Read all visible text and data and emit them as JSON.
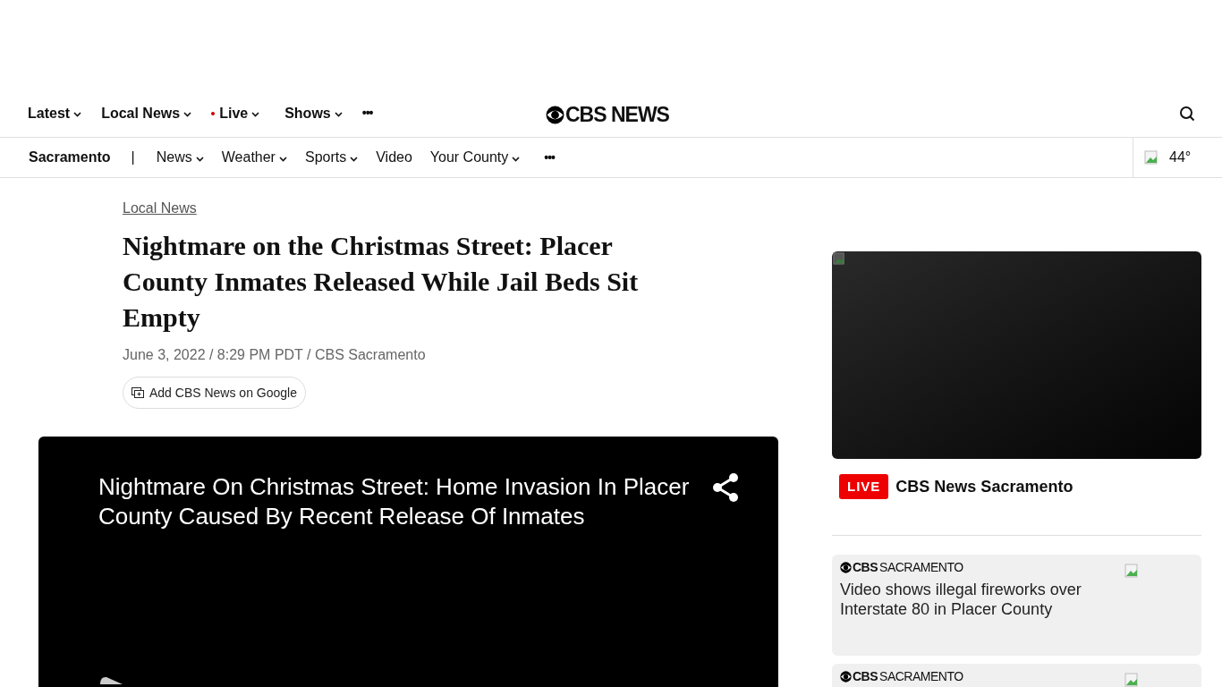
{
  "top_nav": {
    "items": [
      {
        "label": "Latest",
        "dropdown": true,
        "live": false
      },
      {
        "label": "Local News",
        "dropdown": true,
        "live": false
      },
      {
        "label": "Live",
        "dropdown": true,
        "live": true
      },
      {
        "label": "Shows",
        "dropdown": true,
        "live": false
      }
    ],
    "more": "•••",
    "logo": "CBS NEWS"
  },
  "local_nav": {
    "market": "Sacramento",
    "separator": "|",
    "items": [
      {
        "label": "News",
        "dropdown": true
      },
      {
        "label": "Weather",
        "dropdown": true
      },
      {
        "label": "Sports",
        "dropdown": true
      },
      {
        "label": "Video",
        "dropdown": false
      },
      {
        "label": "Your County",
        "dropdown": true
      }
    ],
    "more": "•••",
    "temperature": "44°"
  },
  "article": {
    "category": "Local News",
    "headline": "Nightmare on the Christmas Street: Placer County Inmates Released While Jail Beds Sit Empty",
    "byline": "June 3, 2022 / 8:29 PM PDT / CBS Sacramento",
    "google_button": "Add CBS News on Google",
    "video": {
      "title": "Nightmare On Christmas Street: Home Invasion In Placer County Caused By Recent Release Of Inmates"
    }
  },
  "sidebar": {
    "live_badge": "LIVE",
    "live_title": "CBS News Sacramento",
    "cards": [
      {
        "source": "CBS",
        "source_station": "SACRAMENTO",
        "title": "Video shows illegal fireworks over Interstate 80 in Placer County"
      },
      {
        "source": "CBS",
        "source_station": "SACRAMENTO"
      }
    ]
  }
}
